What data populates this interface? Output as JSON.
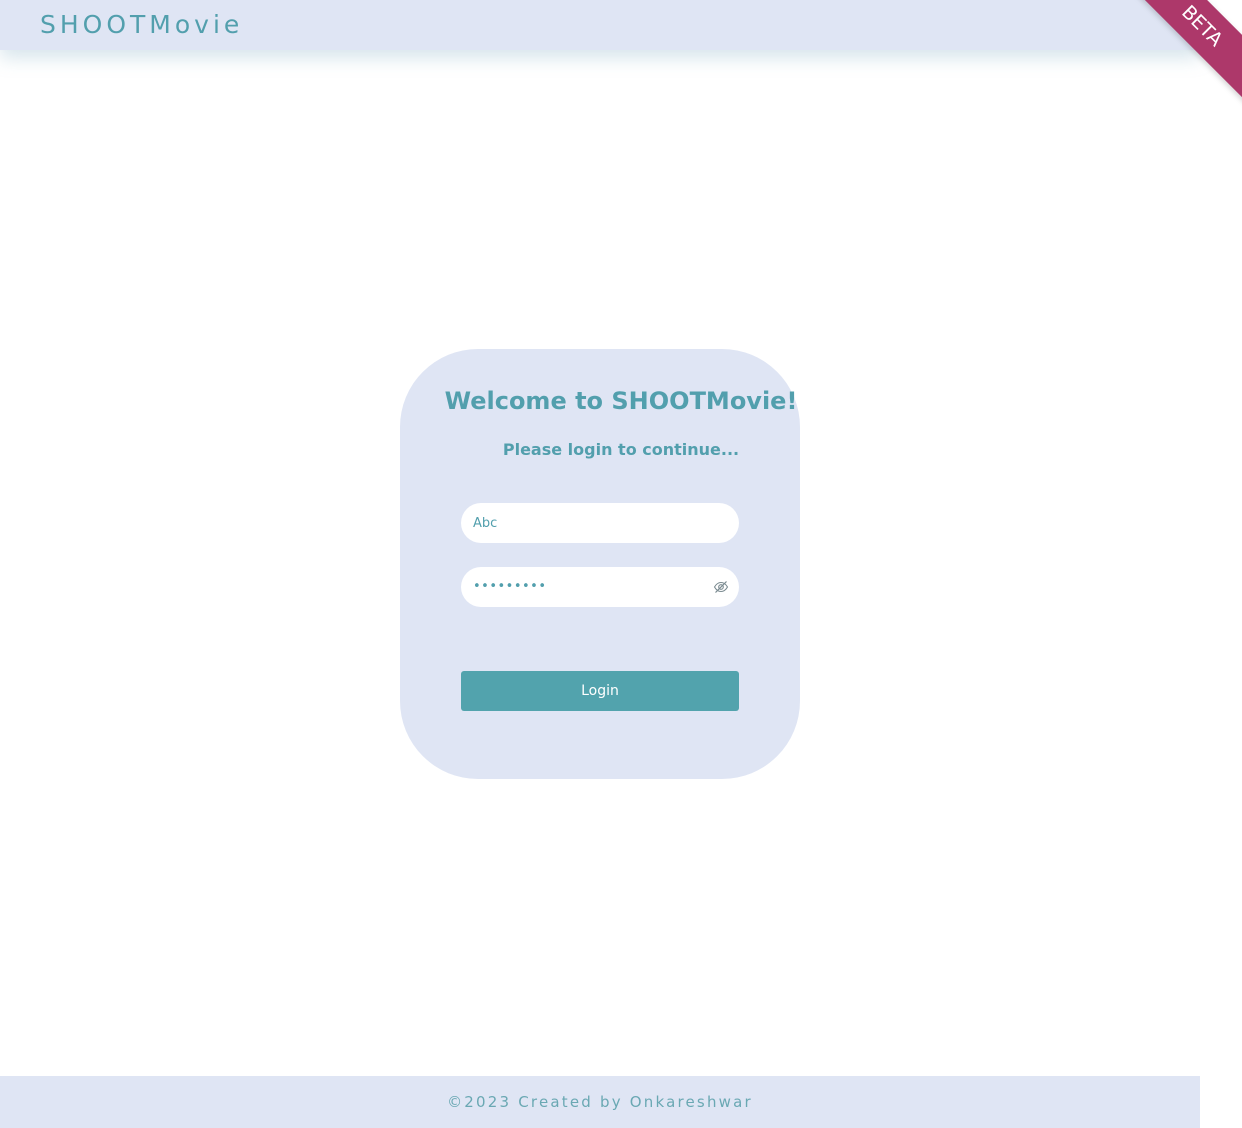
{
  "header": {
    "brand": "SHOOTMovie",
    "ribbon": "BETA"
  },
  "login": {
    "title": "Welcome to SHOOTMovie!",
    "subtitle": "Please login to continue...",
    "username_placeholder": "Abc",
    "password_masked": "•••••••••",
    "toggle_icon": "eye-slash-icon",
    "button_label": "Login"
  },
  "footer": {
    "text": "©2023 Created by Onkareshwar"
  },
  "colors": {
    "accent": "#529fad",
    "panel": "#dfe5f4",
    "ribbon": "#ad386a",
    "button": "#52a3ad"
  }
}
